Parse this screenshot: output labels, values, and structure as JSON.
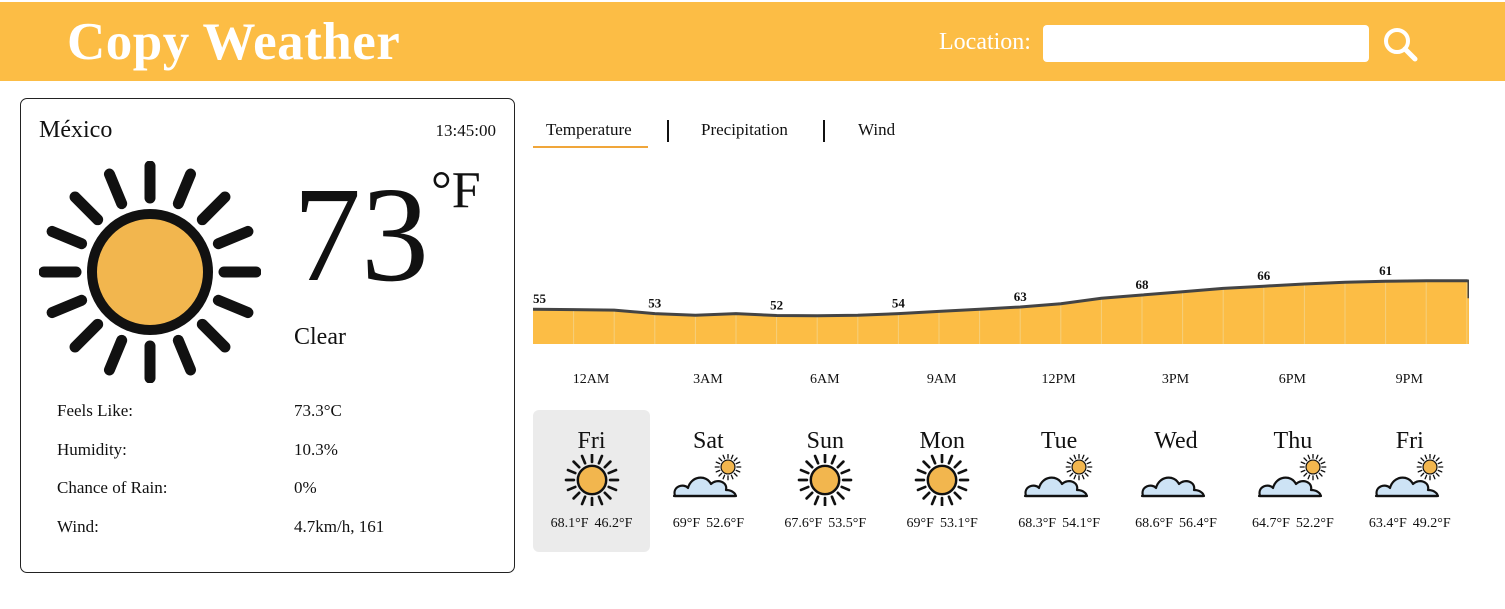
{
  "header": {
    "title": "Copy Weather",
    "location_label": "Location:",
    "location_value": "",
    "search_icon": "search-icon",
    "accent_color": "#fcbd45"
  },
  "current": {
    "city": "México",
    "time": "13:45:00",
    "icon": "sun-icon",
    "temperature": "73",
    "unit": "°F",
    "condition": "Clear",
    "details": [
      {
        "label": "Feels Like:",
        "value": "73.3°C"
      },
      {
        "label": "Humidity:",
        "value": "10.3%"
      },
      {
        "label": "Chance of Rain:",
        "value": "0%"
      },
      {
        "label": "Wind:",
        "value": "4.7km/h, 161"
      }
    ]
  },
  "tabs": [
    {
      "label": "Temperature",
      "active": true
    },
    {
      "label": "Precipitation",
      "active": false
    },
    {
      "label": "Wind",
      "active": false
    }
  ],
  "chart_data": {
    "type": "area",
    "hourly_values": [
      55,
      54.8,
      54.6,
      53,
      52.2,
      53,
      52.1,
      52,
      52.2,
      53,
      54,
      55,
      56,
      57.5,
      60,
      61.5,
      63,
      64.5,
      65.5,
      66.5,
      67.3,
      67.8,
      68,
      68,
      67.8,
      67.3,
      66.6,
      66,
      65,
      64,
      63,
      62,
      61,
      60
    ],
    "point_labels": [
      {
        "index": 0,
        "label": "55"
      },
      {
        "index": 3,
        "label": "53"
      },
      {
        "index": 6,
        "label": "52"
      },
      {
        "index": 9,
        "label": "54"
      },
      {
        "index": 12,
        "label": "63"
      },
      {
        "index": 15,
        "label": "68"
      },
      {
        "index": 18,
        "label": "66"
      },
      {
        "index": 21,
        "label": "61"
      }
    ],
    "x_tick_labels": [
      "12AM",
      "3AM",
      "6AM",
      "9AM",
      "12PM",
      "3PM",
      "6PM",
      "9PM"
    ],
    "fill_color": "#fcbd45",
    "line_color": "#444444"
  },
  "forecast": [
    {
      "day": "Fri",
      "icon": "sun-icon",
      "high": "68.1°F",
      "low": "46.2°F",
      "selected": true
    },
    {
      "day": "Sat",
      "icon": "partly-cloudy-icon",
      "high": "69°F",
      "low": "52.6°F",
      "selected": false
    },
    {
      "day": "Sun",
      "icon": "sun-icon",
      "high": "67.6°F",
      "low": "53.5°F",
      "selected": false
    },
    {
      "day": "Mon",
      "icon": "sun-icon",
      "high": "69°F",
      "low": "53.1°F",
      "selected": false
    },
    {
      "day": "Tue",
      "icon": "partly-cloudy-icon",
      "high": "68.3°F",
      "low": "54.1°F",
      "selected": false
    },
    {
      "day": "Wed",
      "icon": "cloud-icon",
      "high": "68.6°F",
      "low": "56.4°F",
      "selected": false
    },
    {
      "day": "Thu",
      "icon": "partly-cloudy-icon",
      "high": "64.7°F",
      "low": "52.2°F",
      "selected": false
    },
    {
      "day": "Fri",
      "icon": "partly-cloudy-icon",
      "high": "63.4°F",
      "low": "49.2°F",
      "selected": false
    }
  ]
}
